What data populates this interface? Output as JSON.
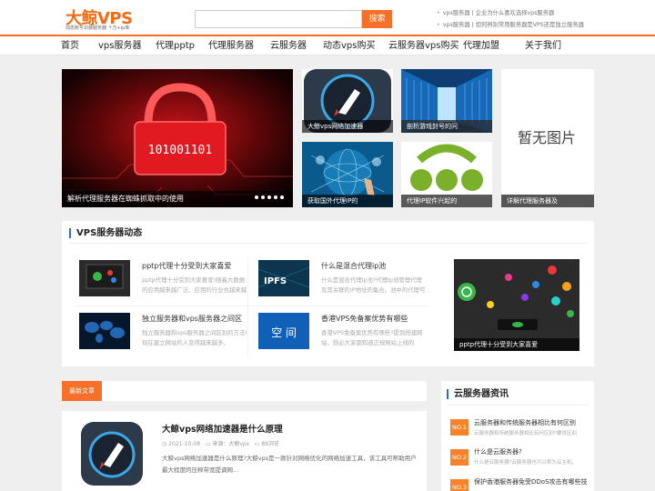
{
  "header": {
    "logo_text": "大鲸VPS",
    "logo_tagline": "动态账号识装服务器 十万+ip库",
    "search_placeholder": "",
    "search_button": "搜索",
    "top_links": [
      "vps服务器 | 企业为什么喜欢选择vps服务器",
      "vps服务器 | 如何辨别常用服务器是VPS还是独立服务器"
    ]
  },
  "nav": {
    "items": [
      "首页",
      "vps服务器",
      "代理pptp",
      "代理服务器",
      "云服务器",
      "动态vps购买",
      "云服务器vps购买",
      "代理加盟",
      "关于我们"
    ]
  },
  "slider": {
    "main_caption": "解析代理服务器在蜘蛛抓取中的使用",
    "main_image_text": "101001101",
    "dots_count": 5,
    "tiles": [
      {
        "caption": "大鲸vps网络加速器"
      },
      {
        "caption": "剖析游戏封号的问"
      },
      {
        "caption": "暂无图片",
        "subcaption": "详解代理服务器及"
      },
      {
        "caption": "获取国外代理IP的"
      },
      {
        "caption": "代理IP软件兴起的"
      }
    ]
  },
  "vps_section": {
    "title": "VPS服务器动态",
    "items": [
      {
        "title": "pptp代理十分受到大家喜爱",
        "desc": "pptp代理十分受到大家喜爱!随着大数据的应用越来越广泛，应用的行业也越来越多"
      },
      {
        "title": "什么是混合代理ip池",
        "desc": "什么是混合代理ip池?代理ip池管理代理及其关联的IP地址的集合。池中的代理可"
      },
      {
        "title": "独立服务器和vps服务器之间区",
        "desc": "独立服务器和vps服务器之间区别的方法!现在建立网站的人变得越来越多，"
      },
      {
        "title": "香港VPS免备案优势有哪些",
        "desc": "香港VPS免备案优势有哪些?提到搭建网站，想必大家都知道正规网站上线的"
      }
    ],
    "feature_caption": "pptp代理十分受到大家喜爱",
    "ipfs_text": "IPFS",
    "kongjian_text": "空 间"
  },
  "latest": {
    "label": "最新文章",
    "article": {
      "title": "大鲸vps网络加速器是什么原理",
      "date": "2021-10-08",
      "source": "来源：大鲸vps",
      "views": "89浏览",
      "desc": "大鲸vps网络加速器是什么原理?大鲸vps是一款针对网络优化的网络加速工具，该工具可帮助用户最大程度的压榨带宽提调网..."
    }
  },
  "cloud_section": {
    "title": "云服务器资讯",
    "items": [
      {
        "num": "NO.1",
        "title": "云服务器和传统服务器相比有何区别",
        "desc": "云服务器和传统服务器相比有何区别?要说区别"
      },
      {
        "num": "NO.2",
        "title": "什么是云服务器?",
        "desc": "什么是云服务器?云服务器也可以称为云主机，"
      },
      {
        "num": "NO.3",
        "title": "保护香港服务器免受DDoS攻击有哪些技",
        "desc": ""
      }
    ]
  },
  "colors": {
    "accent": "#f6702a",
    "section_bar": "#2a6ad8",
    "badge": "#f7822a"
  }
}
